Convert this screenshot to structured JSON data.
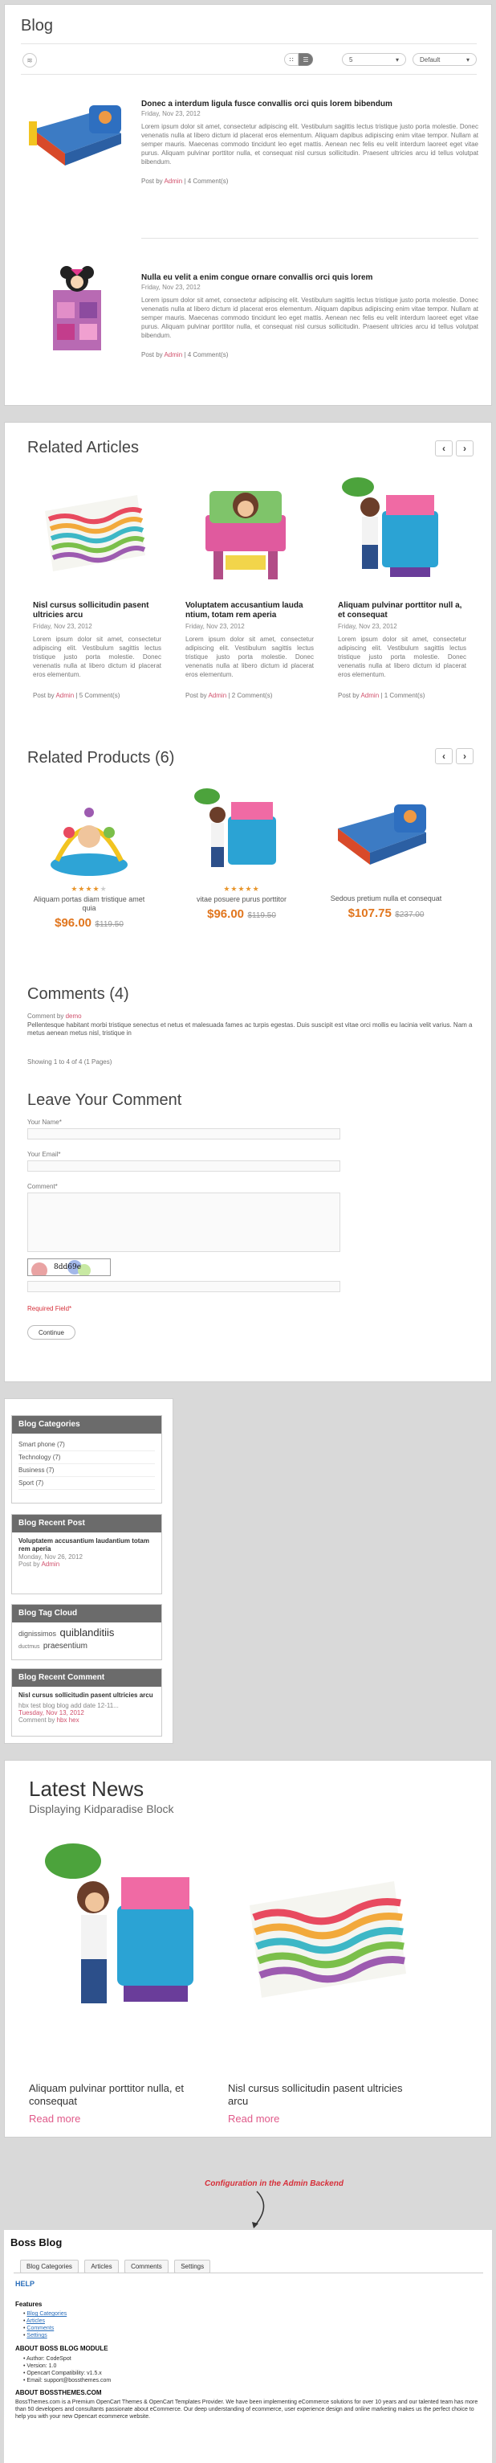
{
  "blog": {
    "title": "Blog",
    "limit_value": "5",
    "sort_value": "Default",
    "posts": [
      {
        "title": "Donec a interdum ligula fusce convallis orci quis lorem bibendum",
        "date": "Friday, Nov 23, 2012",
        "text": "Lorem ipsum dolor sit amet, consectetur adipiscing elit. Vestibulum sagittis lectus tristique justo porta molestie. Donec venenatis nulla at libero dictum id placerat eros elementum. Aliquam dapibus adipiscing enim vitae tempor. Nullam at semper mauris. Maecenas commodo tincidunt leo eget mattis. Aenean nec felis eu velit interdum laoreet eget vitae purus. Aliquam pulvinar porttitor nulla, et consequat nisl cursus sollicitudin. Praesent ultricies arcu id tellus volutpat bibendum.",
        "post_by": "Post by",
        "author": "Admin",
        "comments": "| 4 Comment(s)"
      },
      {
        "title": "Nulla eu velit a enim congue ornare convallis orci quis lorem",
        "date": "Friday, Nov 23, 2012",
        "text": "Lorem ipsum dolor sit amet, consectetur adipiscing elit. Vestibulum sagittis lectus tristique justo porta molestie. Donec venenatis nulla at libero dictum id placerat eros elementum. Aliquam dapibus adipiscing enim vitae tempor. Nullam at semper mauris. Maecenas commodo tincidunt leo eget mattis. Aenean nec felis eu velit interdum laoreet eget vitae purus. Aliquam pulvinar porttitor nulla, et consequat nisl cursus sollicitudin. Praesent ultricies arcu id tellus volutpat bibendum.",
        "post_by": "Post by",
        "author": "Admin",
        "comments": "| 4 Comment(s)"
      }
    ]
  },
  "related_articles": {
    "title": "Related Articles",
    "items": [
      {
        "title": "Nisl cursus sollicitudin pasent ultricies arcu",
        "date": "Friday, Nov 23, 2012",
        "text": "Lorem ipsum dolor sit amet, consectetur adipiscing elit. Vestibulum sagittis lectus tristique justo porta molestie. Donec venenatis nulla at libero dictum id placerat eros elementum.",
        "post_by": "Post by",
        "author": "Admin",
        "comments": "| 5 Comment(s)"
      },
      {
        "title": "Voluptatem accusantium lauda ntium, totam rem aperia",
        "date": "Friday, Nov 23, 2012",
        "text": "Lorem ipsum dolor sit amet, consectetur adipiscing elit. Vestibulum sagittis lectus tristique justo porta molestie. Donec venenatis nulla at libero dictum id placerat eros elementum.",
        "post_by": "Post by",
        "author": "Admin",
        "comments": "| 2 Comment(s)"
      },
      {
        "title": "Aliquam pulvinar porttitor null a, et consequat",
        "date": "Friday, Nov 23, 2012",
        "text": "Lorem ipsum dolor sit amet, consectetur adipiscing elit. Vestibulum sagittis lectus tristique justo porta molestie. Donec venenatis nulla at libero dictum id placerat eros elementum.",
        "post_by": "Post by",
        "author": "Admin",
        "comments": "| 1 Comment(s)"
      }
    ]
  },
  "related_products": {
    "title": "Related Products (6)",
    "items": [
      {
        "name": "Aliquam portas diam tristique amet quia",
        "price": "$96.00",
        "old_price": "$119.50",
        "rating": 4
      },
      {
        "name": "vitae posuere purus porttitor",
        "price": "$96.00",
        "old_price": "$119.50",
        "rating": 5
      },
      {
        "name": "Sedous pretium nulla et consequat",
        "price": "$107.75",
        "old_price": "$237.00",
        "rating": 0
      }
    ]
  },
  "comments": {
    "title": "Comments (4)",
    "comment_by": "Comment by",
    "author": "demo",
    "text": "Pellentesque habitant morbi tristique senectus et netus et malesuada fames ac turpis egestas. Duis suscipit est vitae orci mollis eu lacinia velit varius. Nam a metus aenean metus nisl, tristique in",
    "showing": "Showing 1 to 4 of 4 (1 Pages)"
  },
  "leave_comment": {
    "title": "Leave Your Comment",
    "name_label": "Your Name*",
    "email_label": "Your Email*",
    "comment_label": "Comment*",
    "captcha_text": "8dd69e",
    "required": "Required Field*",
    "continue": "Continue"
  },
  "sidebar": {
    "categories_title": "Blog Categories",
    "categories": [
      "Smart phone (7)",
      "Technology (7)",
      "Business (7)",
      "Sport (7)"
    ],
    "recent_post_title": "Blog Recent Post",
    "recent_post": {
      "title": "Voluptatem accusantium laudantium totam rem aperia",
      "date": "Monday, Nov 26, 2012",
      "post_by": "Post by",
      "author": "Admin"
    },
    "tag_cloud_title": "Blog Tag Cloud",
    "tags": [
      "dignissimos",
      "quiblanditiis",
      "ductmus",
      "praesentium"
    ],
    "recent_comment_title": "Blog Recent Comment",
    "recent_comment": {
      "title": "Nisl cursus sollicitudin pasent ultricies arcu",
      "text": "hbx test blog blog add date 12-11...",
      "date": "Tuesday, Nov 13, 2012",
      "comment_by": "Comment by",
      "author": "hbx hex"
    }
  },
  "latest_news": {
    "title": "Latest News",
    "subtitle": "Displaying Kidparadise Block",
    "items": [
      {
        "title": "Aliquam pulvinar porttitor nulla, et consequat",
        "read_more": "Read more"
      },
      {
        "title": "Nisl cursus sollicitudin pasent ultricies arcu",
        "read_more": "Read more"
      }
    ]
  },
  "config_note": "Configuration in the Admin Backend",
  "admin": {
    "title": "Boss Blog",
    "tabs": [
      "Blog Categories",
      "Articles",
      "Comments",
      "Settings"
    ],
    "help": "HELP",
    "features_title": "Features",
    "features": [
      "Blog Categories",
      "Articles",
      "Comments",
      "Settings"
    ],
    "about_module_title": "ABOUT BOSS BLOG MODULE",
    "about_module": [
      "Author: CodeSpot",
      "Version: 1.0",
      "Opencart Compatibility: v1.5.x",
      "Email: support@bossthemes.com"
    ],
    "about_themes_title": "ABOUT BOSSTHEMES.COM",
    "about_themes_text": "BossThemes.com is a Premium OpenCart Themes & OpenCart Templates Provider. We have been implementing eCommerce solutions for over 10 years and our talented team has more than 50 developers and consultants passionate about eCommerce. Our deep understanding of ecommerce, user experience design and online marketing makes us the perfect choice to help you with your new Opencart ecommerce website."
  }
}
